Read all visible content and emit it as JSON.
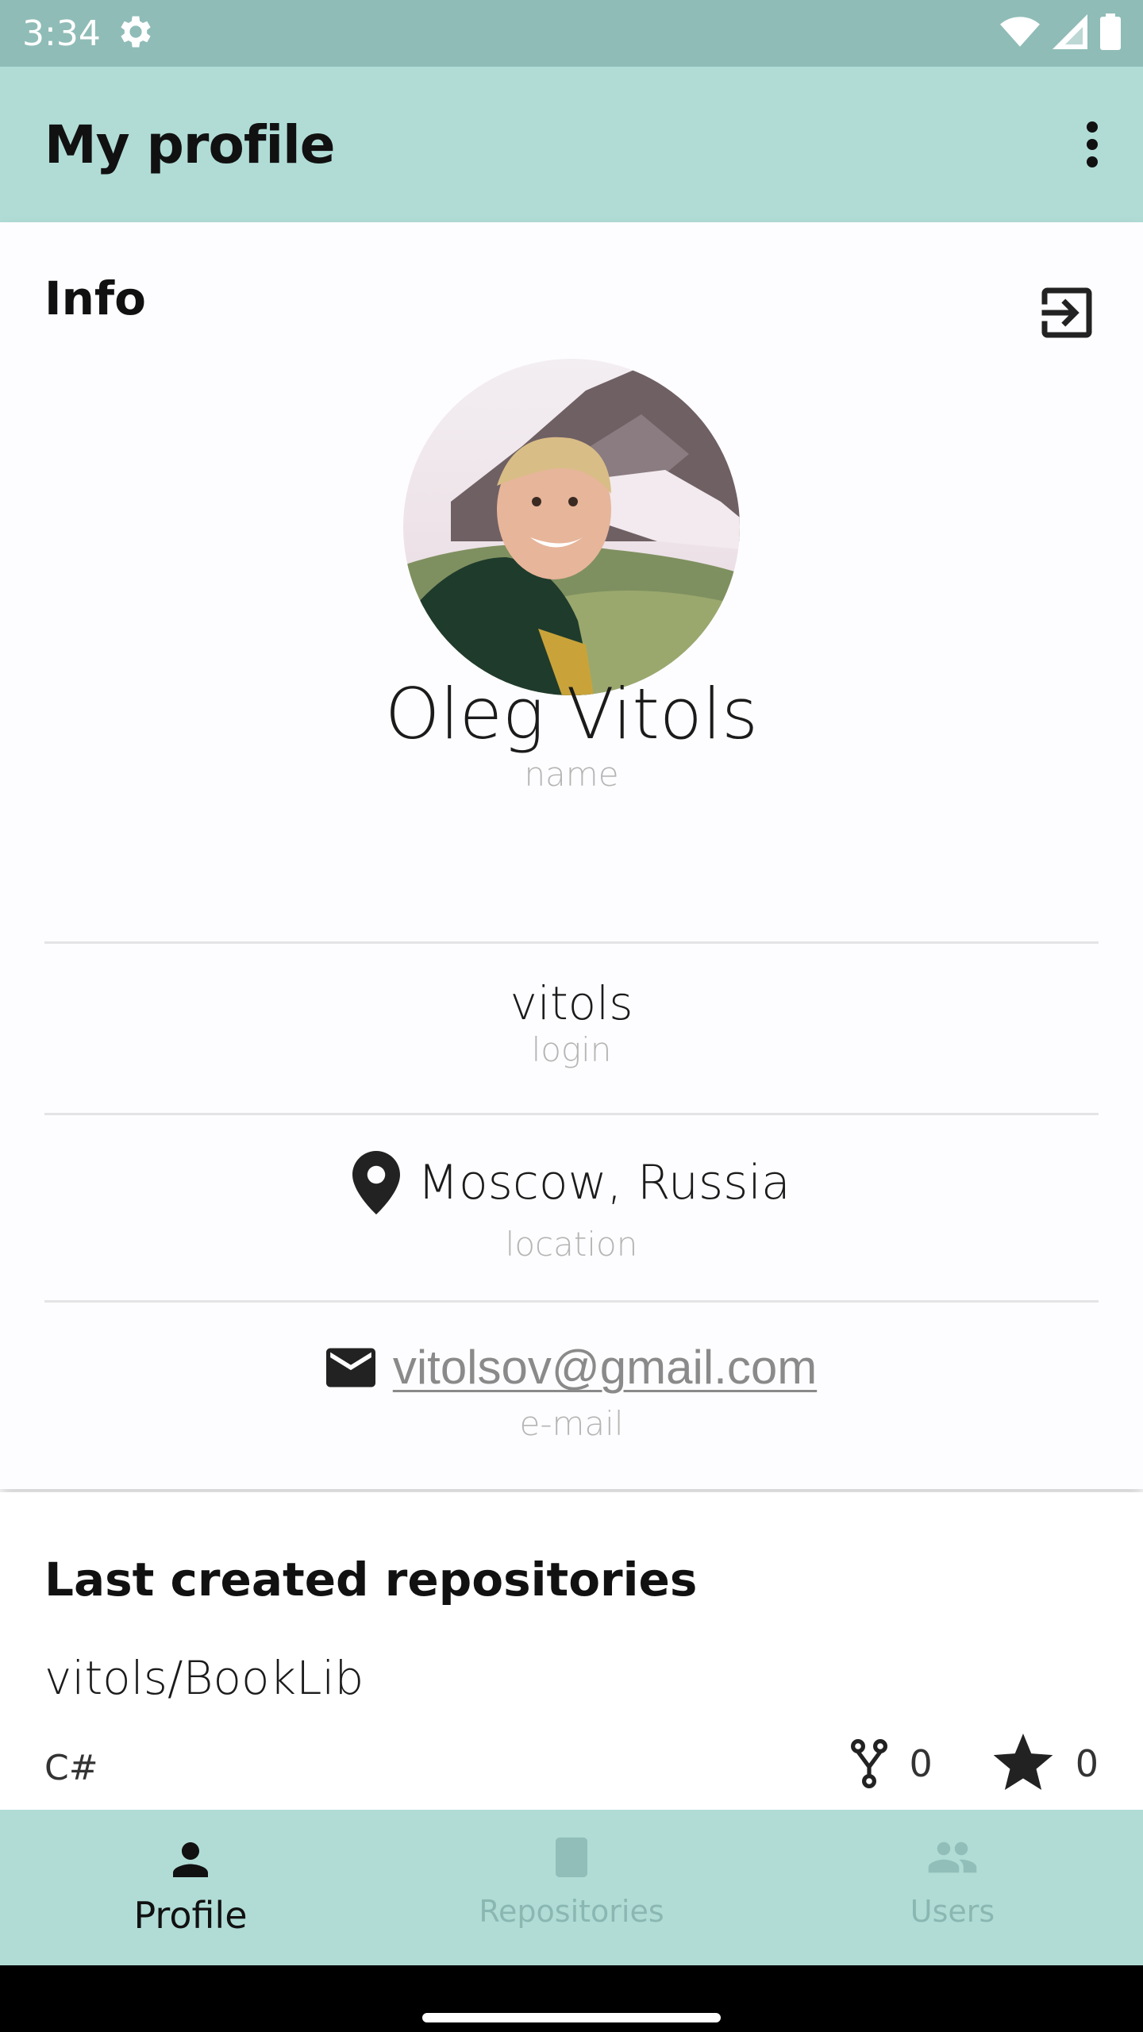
{
  "status_bar": {
    "time": "3:34"
  },
  "app_bar": {
    "title": "My profile"
  },
  "info": {
    "title": "Info",
    "name": {
      "value": "Oleg Vitols",
      "label": "name"
    },
    "login": {
      "value": "vitols",
      "label": "login"
    },
    "location": {
      "value": "Moscow, Russia",
      "label": "location"
    },
    "email": {
      "value": "vitolsov@gmail.com",
      "label": "e-mail"
    }
  },
  "repositories": {
    "title": "Last created repositories",
    "items": [
      {
        "name": "vitols/BookLib",
        "language": "C#",
        "forks": "0",
        "stars": "0"
      }
    ]
  },
  "bottom_nav": {
    "items": [
      {
        "label": "Profile",
        "icon": "person-icon",
        "active": true
      },
      {
        "label": "Repositories",
        "icon": "book-icon",
        "active": false
      },
      {
        "label": "Users",
        "icon": "group-icon",
        "active": false
      }
    ]
  },
  "colors": {
    "status_bar": "#8fbcb7",
    "app_bar": "#b1dcd6",
    "bottom_nav": "#b1dcd6"
  }
}
